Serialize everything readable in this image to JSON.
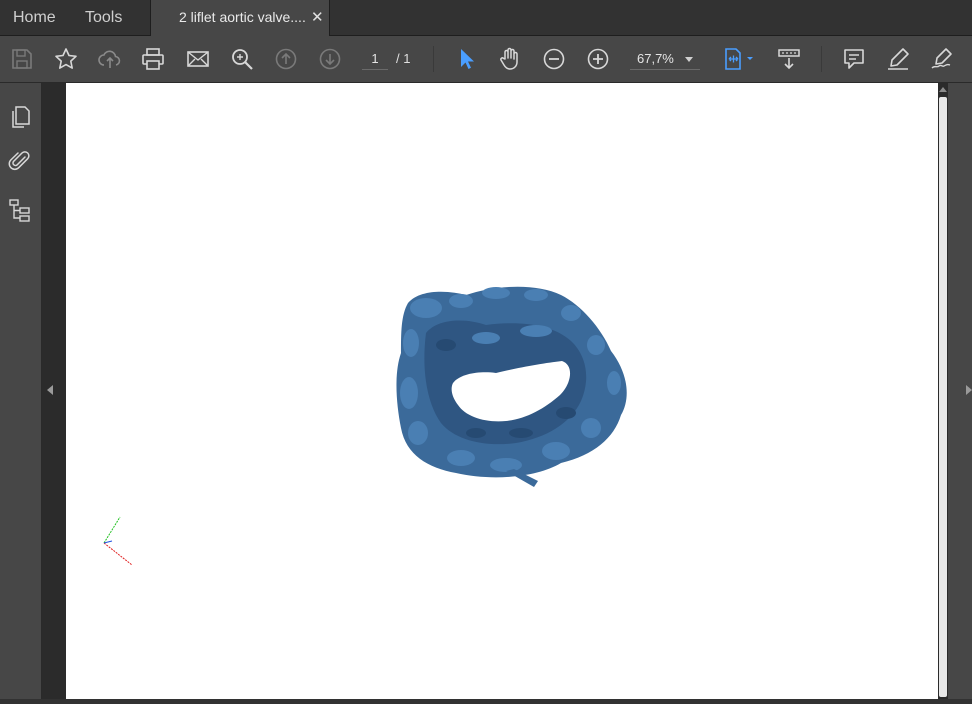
{
  "tabs": {
    "home": "Home",
    "tools": "Tools",
    "document": "2 liflet aortic valve....",
    "close_glyph": "✕"
  },
  "toolbar": {
    "icons": [
      "save-icon",
      "bookmark-star-icon",
      "cloud-upload-icon",
      "print-icon",
      "email-icon",
      "search-zoom-icon",
      "previous-page-icon",
      "next-page-icon",
      "select-cursor-icon",
      "hand-tool-icon",
      "zoom-out-icon",
      "zoom-in-icon",
      "fit-page-icon",
      "scroll-mode-icon",
      "comment-icon",
      "highlight-pen-icon",
      "sign-icon"
    ],
    "page_current": "1",
    "page_total": "/ 1",
    "zoom_value": "67,7%"
  },
  "left_rail": {
    "icons": [
      "page-thumbnails-icon",
      "attachments-icon",
      "model-tree-icon"
    ]
  },
  "colors": {
    "accent": "#4a9eff",
    "model": "#3b6a9a",
    "chrome_dark": "#323232",
    "chrome_mid": "#474747"
  }
}
